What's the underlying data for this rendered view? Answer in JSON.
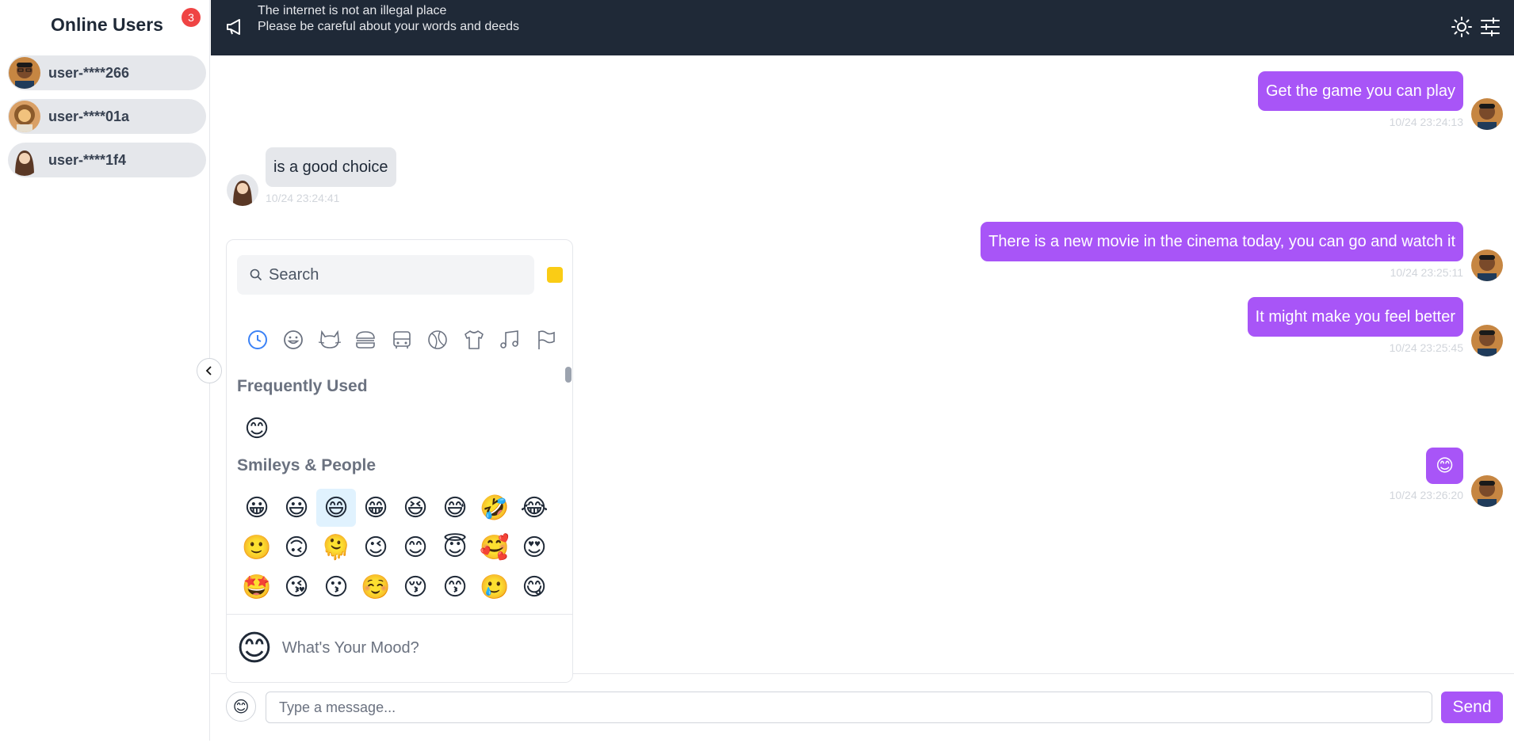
{
  "sidebar": {
    "title": "Online Users",
    "online_count": "3",
    "users": [
      {
        "name": "user-****266",
        "avatar": "avatar-man-glasses"
      },
      {
        "name": "user-****01a",
        "avatar": "avatar-woman-curly"
      },
      {
        "name": "user-****1f4",
        "avatar": "avatar-woman-long-hair"
      }
    ]
  },
  "topbar": {
    "notice_line1": "The internet is not an illegal place",
    "notice_line2": "Please be careful about your words and deeds",
    "icons": [
      "megaphone-icon",
      "theme-toggle-icon",
      "settings-sliders-icon"
    ]
  },
  "messages": [
    {
      "side": "right",
      "text": "Get the game you can play",
      "time": "10/24 23:24:13"
    },
    {
      "side": "left",
      "text": "is a good choice",
      "time": "10/24 23:24:41"
    },
    {
      "side": "right",
      "text": "There is a new movie in the cinema today, you can go and watch it",
      "time": "10/24 23:25:11"
    },
    {
      "side": "right",
      "text": "It might make you feel better",
      "time": "10/24 23:25:45"
    },
    {
      "side": "right",
      "text": "😊",
      "time": "10/24 23:26:20"
    }
  ],
  "emoji_picker": {
    "search_placeholder": "Search",
    "categories": [
      "recent-icon",
      "smiley-icon",
      "animal-icon",
      "food-icon",
      "travel-icon",
      "activity-icon",
      "objects-icon",
      "symbols-icon",
      "flags-icon"
    ],
    "frequently_used_label": "Frequently Used",
    "frequently_used": [
      "😊"
    ],
    "smileys_label": "Smileys & People",
    "smileys": [
      [
        "😀",
        "😃",
        "😄",
        "😁",
        "😆",
        "😅",
        "🤣",
        "😂"
      ],
      [
        "🙂",
        "🙃",
        "🫠",
        "😉",
        "😊",
        "😇",
        "🥰",
        "😍"
      ],
      [
        "🤩",
        "😘",
        "😗",
        "☺️",
        "😚",
        "😙",
        "🥲",
        "😋"
      ]
    ],
    "footer_emoji": "😊",
    "footer_text": "What's Your Mood?"
  },
  "composer": {
    "emoji_button": "😊",
    "placeholder": "Type a message...",
    "send_label": "Send"
  },
  "colors": {
    "accent": "#a855f7",
    "topbar": "#1f2937",
    "badge": "#ef4444"
  }
}
